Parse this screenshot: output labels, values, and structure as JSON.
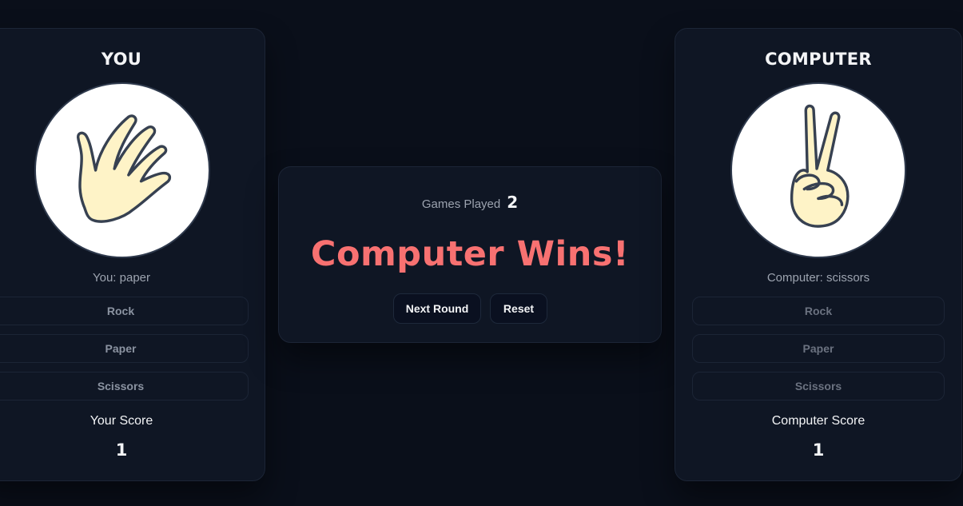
{
  "player": {
    "title": "YOU",
    "choice_text": "You: paper",
    "hand_icon": "paper-hand-icon",
    "buttons": {
      "rock": "Rock",
      "paper": "Paper",
      "scissors": "Scissors"
    },
    "score_label": "Your Score",
    "score": "1"
  },
  "computer": {
    "title": "COMPUTER",
    "choice_text": "Computer: scissors",
    "hand_icon": "scissors-hand-icon",
    "buttons": {
      "rock": "Rock",
      "paper": "Paper",
      "scissors": "Scissors"
    },
    "score_label": "Computer Score",
    "score": "1"
  },
  "center": {
    "games_played_label": "Games Played",
    "games_played": "2",
    "result": "Computer Wins!",
    "next_round_label": "Next Round",
    "reset_label": "Reset"
  },
  "colors": {
    "background": "#0a0f1a",
    "card": "#0f1624",
    "result_red": "#f87171",
    "hand_fill": "#fef3c7"
  }
}
